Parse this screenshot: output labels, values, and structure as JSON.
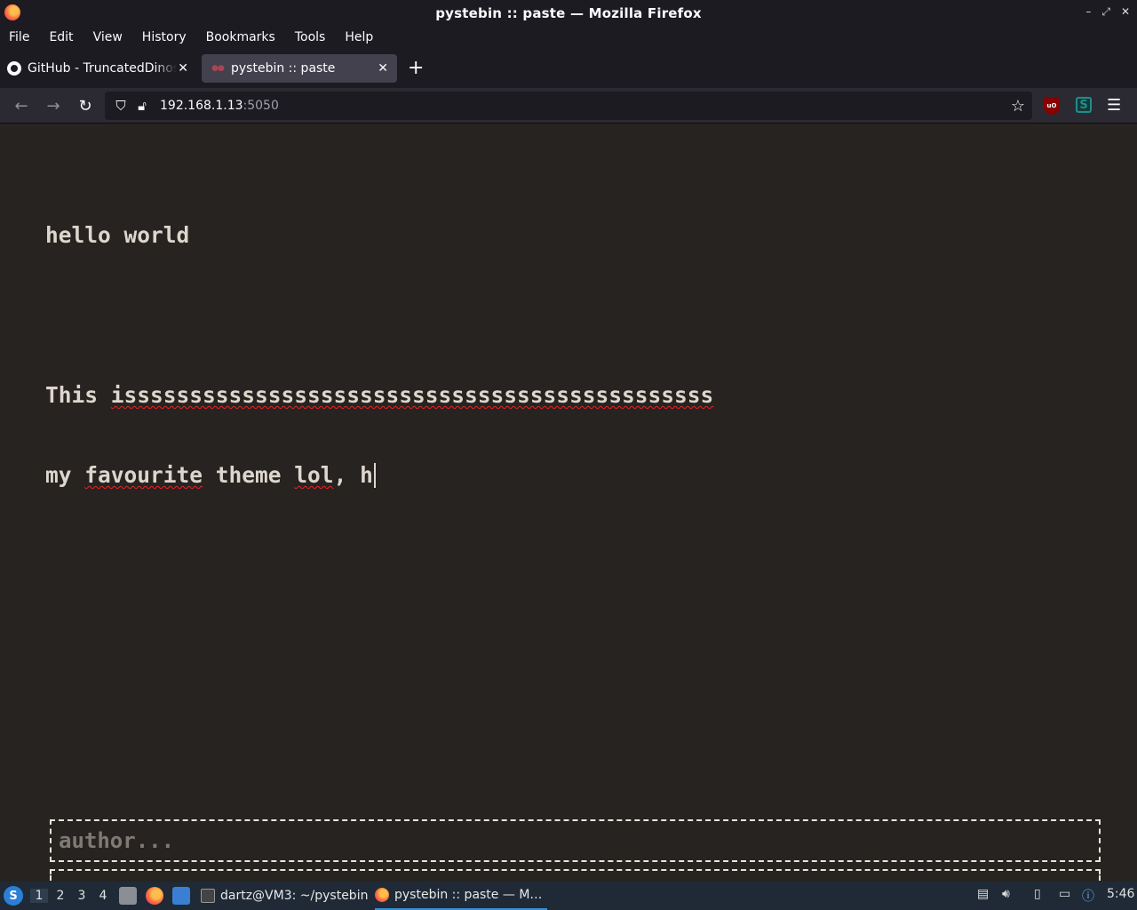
{
  "window": {
    "title": "pystebin :: paste — Mozilla Firefox",
    "controls": {
      "minimize": "–",
      "restore": "⤢",
      "close": "✕"
    }
  },
  "menu": {
    "items": [
      {
        "label": "File"
      },
      {
        "label": "Edit"
      },
      {
        "label": "View"
      },
      {
        "label": "History"
      },
      {
        "label": "Bookmarks"
      },
      {
        "label": "Tools"
      },
      {
        "label": "Help"
      }
    ]
  },
  "tabs": [
    {
      "label": "GitHub - TruncatedDinosaur",
      "active": false,
      "icon": "github-icon"
    },
    {
      "label": "pystebin :: paste",
      "active": true,
      "icon": "pystebin-favicon-icon"
    }
  ],
  "tab_close": "✕",
  "new_tab": "+",
  "nav": {
    "url_host": "192.168.1.13",
    "url_port": ":5050"
  },
  "paste": {
    "line1": "hello world",
    "line2": "",
    "line3_prefix": "This ",
    "line3_word": "isssssssssssssssssssssssssssssssssssssssssssss",
    "line4_a": "my ",
    "line4_b": "favourite",
    "line4_c": " theme ",
    "line4_d": "lol",
    "line4_e": ", h"
  },
  "author": {
    "placeholder": "author..."
  },
  "taskbar": {
    "workspaces": [
      "1",
      "2",
      "3",
      "4"
    ],
    "tasks": [
      {
        "label": "dartz@VM3: ~/pystebin"
      },
      {
        "label": "pystebin :: paste — M…"
      }
    ],
    "clock": "5:46"
  },
  "colors": {
    "page_bg": "#262321",
    "text": "#ddd6cc",
    "spell_underline": "#e22"
  }
}
